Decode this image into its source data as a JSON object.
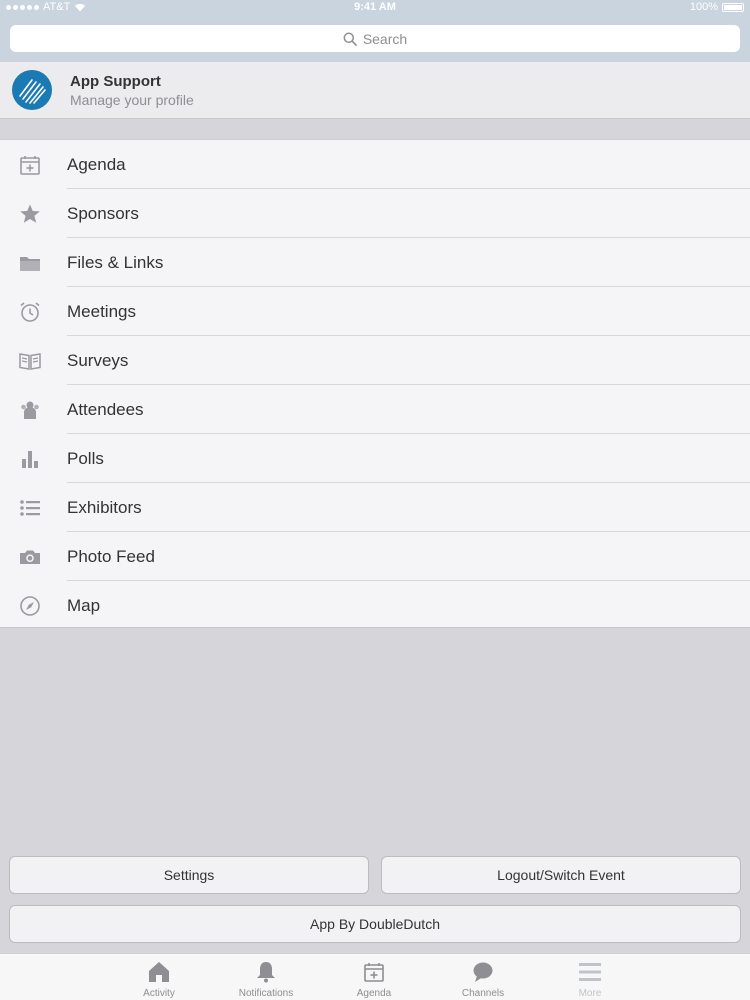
{
  "status_bar": {
    "carrier": "AT&T",
    "time": "9:41 AM",
    "battery": "100%"
  },
  "search": {
    "placeholder": "Search"
  },
  "profile": {
    "name": "App Support",
    "subtitle": "Manage your profile"
  },
  "menu": {
    "items": [
      {
        "label": "Agenda",
        "icon": "calendar-icon"
      },
      {
        "label": "Sponsors",
        "icon": "star-icon"
      },
      {
        "label": "Files & Links",
        "icon": "folder-icon"
      },
      {
        "label": "Meetings",
        "icon": "alarm-clock-icon"
      },
      {
        "label": "Surveys",
        "icon": "open-book-icon"
      },
      {
        "label": "Attendees",
        "icon": "people-icon"
      },
      {
        "label": "Polls",
        "icon": "bar-chart-icon"
      },
      {
        "label": "Exhibitors",
        "icon": "list-icon"
      },
      {
        "label": "Photo Feed",
        "icon": "camera-icon"
      },
      {
        "label": "Map",
        "icon": "compass-icon"
      }
    ]
  },
  "buttons": {
    "settings": "Settings",
    "logout": "Logout/Switch Event",
    "app_by": "App By DoubleDutch"
  },
  "tabbar": {
    "tabs": [
      {
        "label": "Activity",
        "icon": "home-icon"
      },
      {
        "label": "Notifications",
        "icon": "bell-icon"
      },
      {
        "label": "Agenda",
        "icon": "calendar-icon"
      },
      {
        "label": "Channels",
        "icon": "chat-bubble-icon"
      },
      {
        "label": "More",
        "icon": "menu-lines-icon",
        "active": true
      }
    ]
  },
  "colors": {
    "icon_gray": "#9a9aa0",
    "avatar_blue": "#1a7ab4"
  }
}
